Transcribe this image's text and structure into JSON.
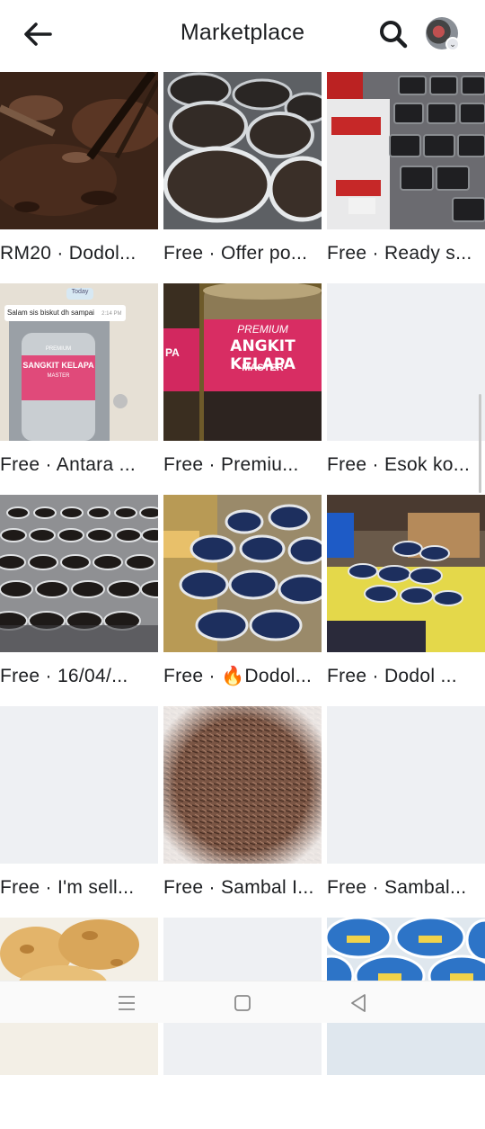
{
  "header": {
    "title": "Marketplace",
    "back_icon": "arrow-left-icon",
    "search_icon": "search-icon",
    "profile_icon": "avatar"
  },
  "listings": [
    {
      "label": "RM20 · Dodol...",
      "image": "chocolate-dodol-stirring"
    },
    {
      "label": "Free · Offer po...",
      "image": "dodol-cups-closeup"
    },
    {
      "label": "Free · Ready s...",
      "image": "packed-containers-express"
    },
    {
      "label": "Free · Antara ...",
      "image": "chat-screenshot-jar",
      "chat_day": "Today",
      "chat_message": "Salam sis biskut dh sampai",
      "chat_time": "2:14 PM",
      "jar_top": "PREMIUM",
      "jar_text": "SANGKIT KELAPA",
      "jar_sub": "MASTER"
    },
    {
      "label": "Free · Premiu...",
      "image": "premium-jar",
      "jar_top": "PREMIUM",
      "jar_text": "ANGKIT KELAPA",
      "jar_sub": "MASTER",
      "jar_left": "PA"
    },
    {
      "label": "Free · Esok ko...",
      "image": "blank"
    },
    {
      "label": "Free · 16/04/...",
      "image": "many-cups-rows"
    },
    {
      "label": "Free · 🔥Dodol...",
      "image": "stacked-containers-stall"
    },
    {
      "label": "Free · Dodol ...",
      "image": "stall-table-yellow"
    },
    {
      "label": "Free · I'm sell...",
      "image": "blank"
    },
    {
      "label": "Free · Sambal I...",
      "image": "shredded-sambal"
    },
    {
      "label": "Free · Sambal...",
      "image": "blank"
    },
    {
      "label": "",
      "image": "fried-cookies"
    },
    {
      "label": "",
      "image": "blank"
    },
    {
      "label": "",
      "image": "sambal-stickers"
    }
  ],
  "navbar": {
    "menu_icon": "menu-icon",
    "home_icon": "home-square-icon",
    "back_icon": "back-triangle-icon"
  }
}
